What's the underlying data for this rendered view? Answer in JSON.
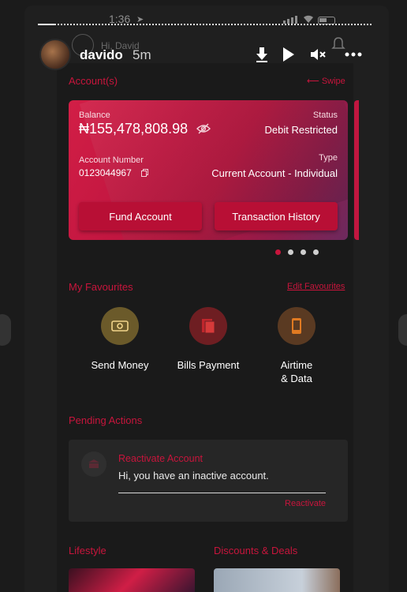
{
  "status_bar": {
    "time": "1:36"
  },
  "story": {
    "progress": 0.05,
    "username": "davido",
    "time_ago": "5m",
    "icons": [
      "download-icon",
      "play-icon",
      "mute-icon",
      "more-icon"
    ]
  },
  "app_header": {
    "greeting": "Hi, David"
  },
  "accounts": {
    "title": "Account(s)",
    "swipe_hint": "⟵ Swipe",
    "card": {
      "balance_label": "Balance",
      "balance": "₦155,478,808.98",
      "status_label": "Status",
      "status": "Debit Restricted",
      "account_number_label": "Account Number",
      "account_number": "0123044967",
      "type_label": "Type",
      "type": "Current Account - Individual",
      "fund_button": "Fund Account",
      "history_button": "Transaction History"
    },
    "pagination": {
      "count": 4,
      "active": 0
    }
  },
  "favourites": {
    "title": "My Favourites",
    "edit_link": "Edit Favourites",
    "items": [
      {
        "label": "Send Money",
        "icon": "money-icon",
        "color": "#6b5a2a"
      },
      {
        "label": "Bills Payment",
        "icon": "bill-icon",
        "color": "#6e1e22"
      },
      {
        "label": "Airtime\n& Data",
        "label_line1": "Airtime",
        "label_line2": "& Data",
        "icon": "phone-icon",
        "color": "#5a3a22"
      }
    ]
  },
  "pending": {
    "title": "Pending Actions",
    "item_title": "Reactivate Account",
    "item_message": "Hi, you have an inactive account.",
    "item_link": "Reactivate"
  },
  "bottom_sections": {
    "lifestyle": "Lifestyle",
    "deals": "Discounts & Deals"
  },
  "colors": {
    "accent": "#c8153c",
    "card": "#c11640",
    "background": "#1b1b1b"
  }
}
